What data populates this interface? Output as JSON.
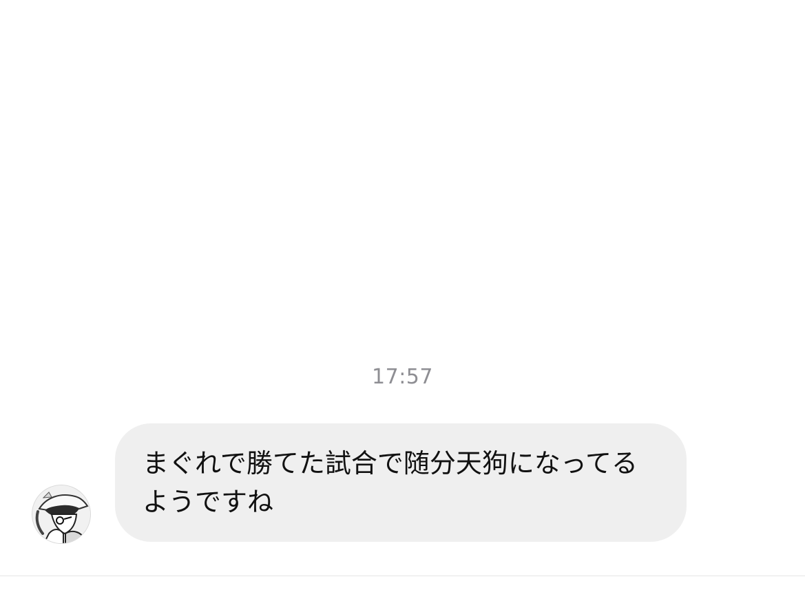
{
  "chat": {
    "timestamp": "17:57",
    "messages": [
      {
        "sender": "other",
        "avatar_icon": "manga-character-avatar-icon",
        "text": "まぐれで勝てた試合で随分天狗になってるようですね"
      }
    ]
  },
  "colors": {
    "background": "#ffffff",
    "bubble": "#efefef",
    "text": "#111111",
    "timestamp": "#8e8e93"
  }
}
